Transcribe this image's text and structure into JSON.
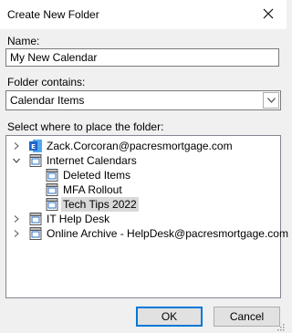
{
  "window": {
    "title": "Create New Folder"
  },
  "name": {
    "label": "Name:",
    "value": "My New Calendar"
  },
  "folder_contains": {
    "label": "Folder contains:",
    "value": "Calendar Items"
  },
  "tree": {
    "label": "Select where to place the folder:",
    "items": [
      {
        "text": "Zack.Corcoran@pacresmortgage.com",
        "expander": "collapsed",
        "icon": "exchange-mailbox-icon"
      },
      {
        "text": "Internet Calendars",
        "expander": "expanded",
        "icon": "calendar-folder-icon"
      },
      {
        "text": "Deleted Items",
        "expander": "none",
        "icon": "calendar-folder-icon"
      },
      {
        "text": "MFA Rollout",
        "expander": "none",
        "icon": "calendar-folder-icon"
      },
      {
        "text": "Tech Tips 2022",
        "expander": "none",
        "icon": "calendar-folder-icon",
        "selected": true
      },
      {
        "text": "IT Help Desk",
        "expander": "collapsed",
        "icon": "calendar-folder-icon"
      },
      {
        "text": "Online Archive - HelpDesk@pacresmortgage.com",
        "expander": "collapsed",
        "icon": "calendar-folder-icon"
      }
    ]
  },
  "buttons": {
    "ok": "OK",
    "cancel": "Cancel"
  },
  "colors": {
    "exchange_blue": "#1f64c9",
    "selection": "#d9d9d9",
    "accent": "#0078d7"
  }
}
